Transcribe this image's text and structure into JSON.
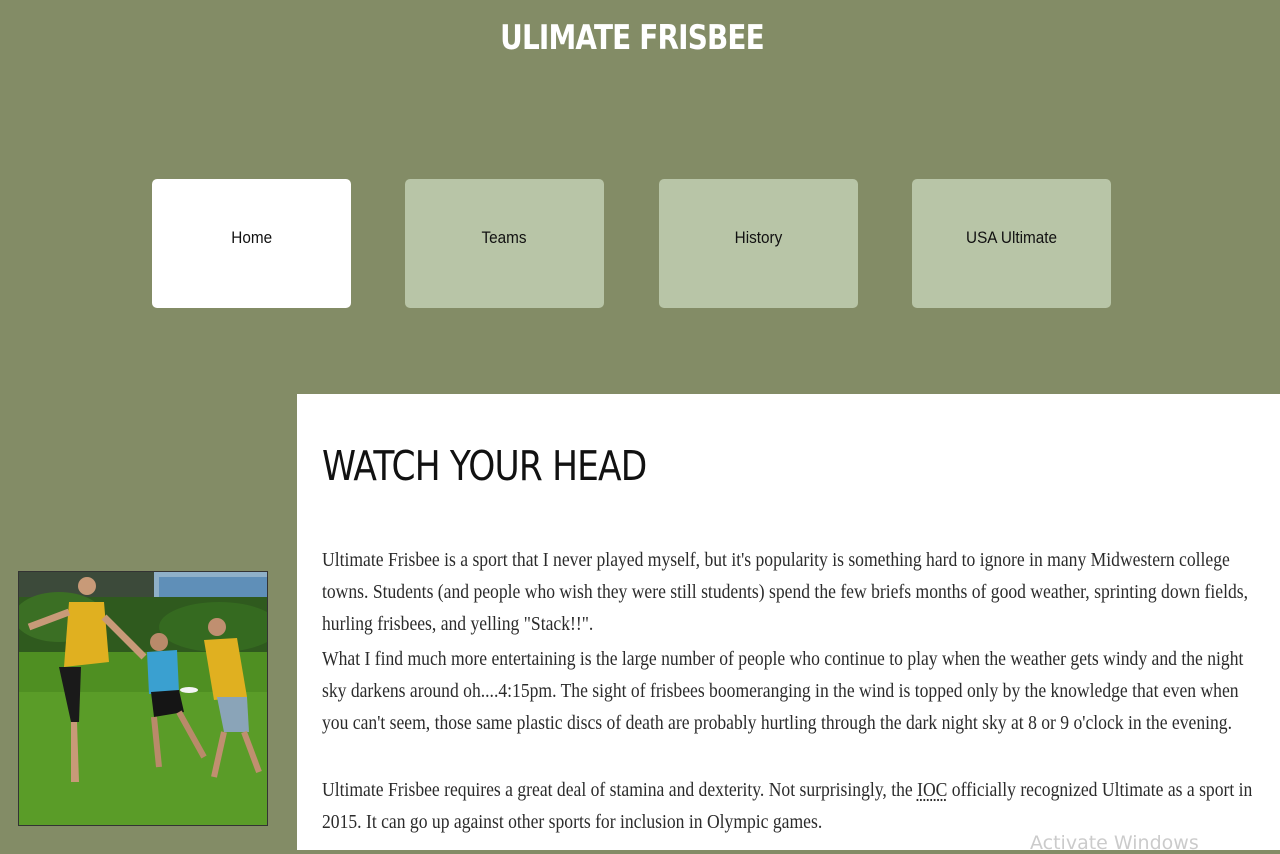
{
  "site": {
    "title": "ULIMATE FRISBEE"
  },
  "nav": {
    "items": [
      {
        "label": "Home",
        "active": true
      },
      {
        "label": "Teams",
        "active": false
      },
      {
        "label": "History",
        "active": false
      },
      {
        "label": "USA Ultimate",
        "active": false
      }
    ]
  },
  "main": {
    "heading": "WATCH YOUR HEAD",
    "paragraphs": [
      "Ultimate Frisbee is a sport that I never played myself, but it's popularity is something hard to ignore in many Midwestern college towns. Students (and people who wish they were still students) spend the few briefs months of good weather, sprinting down fields, hurling frisbees, and yelling \"Stack!!\".",
      "What I find much more entertaining is the large number of people who continue to play when the weather gets windy and the night sky darkens around oh....4:15pm. The sight of frisbees boomeranging in the wind is topped only by the knowledge that even when you can't seem, those same plastic discs of death are probably hurtling through the dark night sky at 8 or 9 o'clock in the evening."
    ],
    "paragraph3": {
      "before": "Ultimate Frisbee requires a great deal of stamina and dexterity. Not surprisingly, the ",
      "link": "IOC",
      "after": " officially recognized Ultimate as a sport in 2015. It can go up against other sports for inclusion in Olympic games."
    }
  },
  "watermark": "Activate Windows",
  "colors": {
    "page_background": "#838c66",
    "nav_inactive": "#b8c5a7",
    "nav_active": "#ffffff"
  }
}
